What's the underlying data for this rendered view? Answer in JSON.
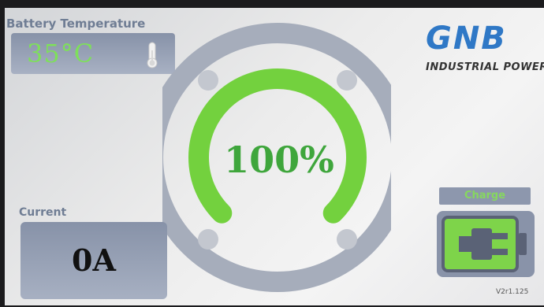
{
  "temperature": {
    "title": "Battery Temperature",
    "value": "35°C",
    "icon": "thermometer-icon"
  },
  "gauge": {
    "percent_label": "100%",
    "level": 100,
    "arc_color": "#73d13e",
    "ring_color": "#a6adbb"
  },
  "current": {
    "title": "Current",
    "value": "0A"
  },
  "logo": {
    "mark": "GNB",
    "subtitle": "INDUSTRIAL POWER"
  },
  "mode": {
    "label": "Charge",
    "icon": "battery-plug-icon"
  },
  "version": "V2r1.125",
  "colors": {
    "accent_green": "#7ee05a",
    "panel_blue": "#8993a9",
    "label_blue": "#6f7d94",
    "logo_blue": "#2f78c6"
  }
}
